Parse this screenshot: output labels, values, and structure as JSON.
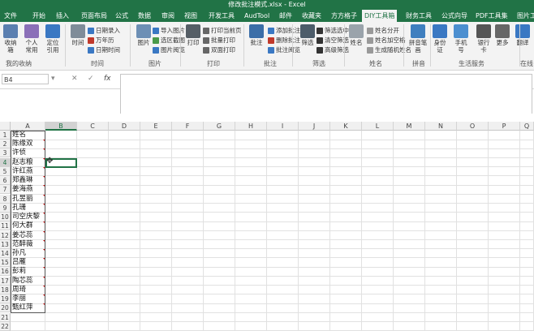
{
  "window": {
    "title": "修改批注模式.xlsx - Excel"
  },
  "tabs": [
    "文件",
    "开始",
    "插入",
    "页面布局",
    "公式",
    "数据",
    "审阅",
    "视图",
    "开发工具",
    "AudTool",
    "邮件",
    "收藏夹",
    "方方格子",
    "DIY工具箱",
    "财务工具",
    "公式向导",
    "PDF工具集",
    "图片工"
  ],
  "active_tab": "DIY工具箱",
  "ribbon": {
    "big_buttons": [
      "收纳箱",
      "个人常用",
      "定位引用",
      "时间",
      "图片",
      "打印",
      "批注",
      "筛选",
      "姓名",
      "拼音笔画",
      "身份证",
      "手机号",
      "银行卡",
      "更多",
      "翻译"
    ],
    "small_buttons": [
      "日期录入",
      "万年历",
      "日期时间",
      "导入图片",
      "选区截图",
      "图片阅览",
      "打印当前页",
      "批量打印",
      "双面打印",
      "添加批注",
      "删除批注",
      "批注阅览",
      "筛选选中",
      "清空筛选",
      "高级筛选",
      "姓名分开",
      "姓名加空格",
      "生成随机姓名"
    ],
    "groups": [
      "我的收纳",
      "时间",
      "图片",
      "打印",
      "批注",
      "筛选",
      "姓名",
      "拼音",
      "生活服务",
      "在线"
    ]
  },
  "formula_bar": {
    "name_box": "B4",
    "fx": "fx",
    "value": ""
  },
  "columns": [
    "A",
    "B",
    "C",
    "D",
    "E",
    "F",
    "G",
    "H",
    "I",
    "J",
    "K",
    "L",
    "M",
    "N",
    "O",
    "P",
    "Q"
  ],
  "selected_cell": "B4",
  "rows": [
    "1",
    "2",
    "3",
    "4",
    "5",
    "6",
    "7",
    "8",
    "9",
    "10",
    "11",
    "12",
    "13",
    "14",
    "15",
    "16",
    "17",
    "18",
    "19",
    "20",
    "21",
    "22"
  ],
  "column_a": [
    "姓名",
    "陈缘双",
    "许侦",
    "赵志粮",
    "许红燕",
    "郑鑫琳",
    "姜海燕",
    "孔昱丽",
    "孔珊",
    "司空庆黎",
    "何大群",
    "姜芯蕊",
    "范醉薇",
    "孙凡",
    "吕雁",
    "彭莉",
    "陶芯蕊",
    "周琦",
    "李丽",
    "甄红萍",
    "",
    ""
  ]
}
